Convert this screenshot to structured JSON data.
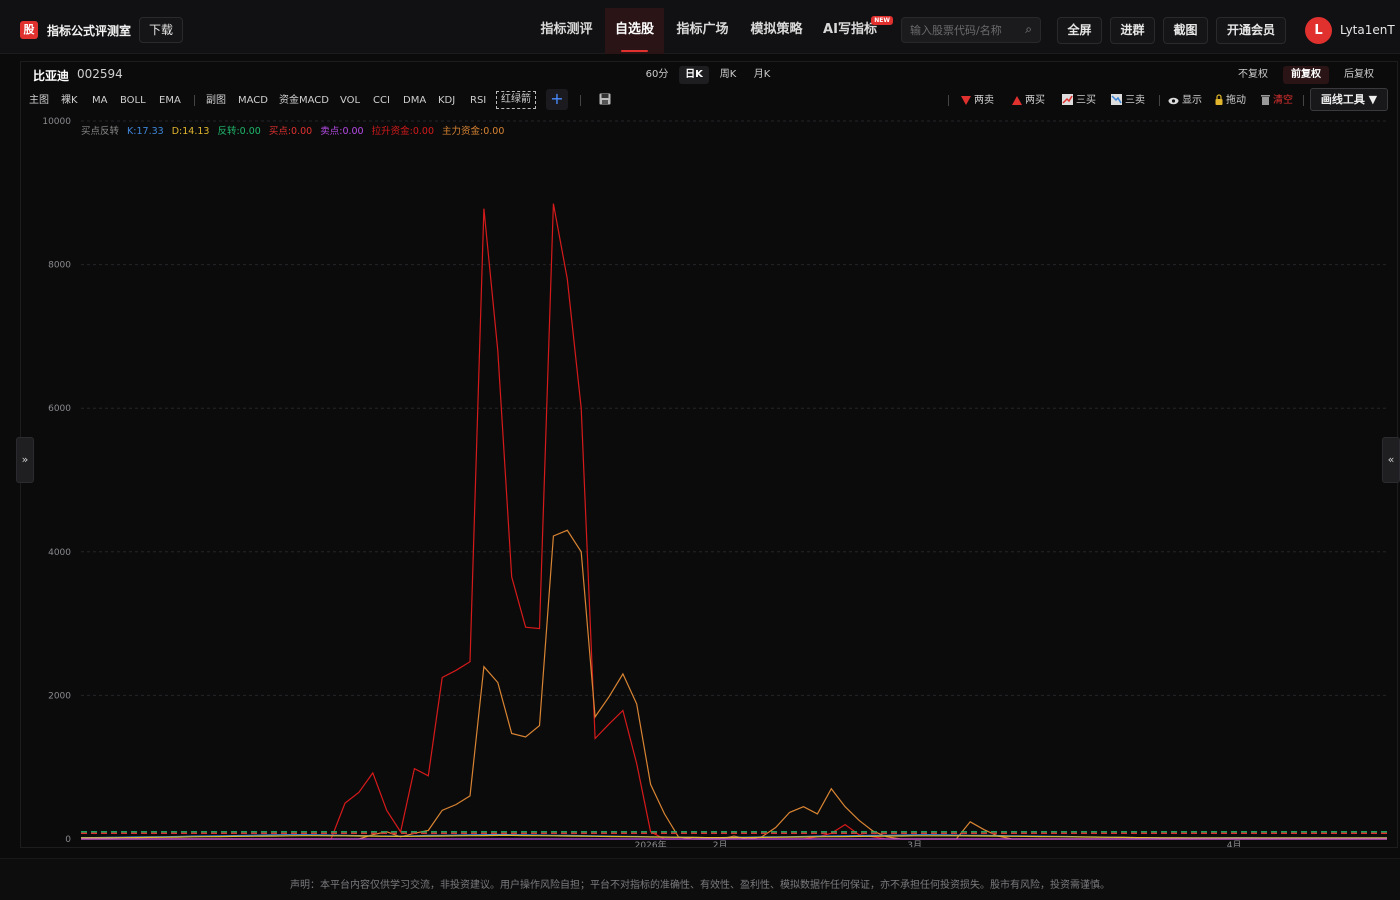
{
  "header": {
    "logo_char": "股",
    "app_title": "指标公式评测室",
    "download": "下载",
    "nav": [
      "指标测评",
      "自选股",
      "指标广场",
      "模拟策略",
      "AI写指标"
    ],
    "nav_active_index": 1,
    "new_badge": "NEW",
    "search_placeholder": "输入股票代码/名称",
    "buttons": [
      "全屏",
      "进群",
      "截图",
      "开通会员"
    ],
    "avatar_letter": "L",
    "username": "Lyta1enT"
  },
  "stock": {
    "name": "比亚迪",
    "code": "002594"
  },
  "periods": [
    "60分",
    "日K",
    "周K",
    "月K"
  ],
  "period_active_index": 1,
  "adjust": [
    "不复权",
    "前复权",
    "后复权"
  ],
  "adjust_active_index": 1,
  "toolbar": {
    "left": [
      "主图",
      "裸K",
      "MA",
      "BOLL",
      "EMA",
      "副图",
      "MACD",
      "资金MACD",
      "VOL",
      "CCI",
      "DMA",
      "KDJ",
      "RSI",
      "红绿箭"
    ],
    "plus": "+",
    "right": [
      "两卖",
      "两买",
      "三买",
      "三卖",
      "显示",
      "拖动",
      "清空"
    ],
    "draw_tool": "画线工具 ▼"
  },
  "indicator_legend": {
    "name": "买点反转",
    "items": [
      "K:17.33",
      "D:14.13",
      "反转:0.00",
      "买点:0.00",
      "卖点:0.00",
      "拉升资金:0.00",
      "主力资金:0.00"
    ]
  },
  "colors": {
    "accent": "#e0312f",
    "k": "#3d86d9",
    "d": "#e1b62c",
    "reverse": "#1fb56a",
    "buy": "#e0312f",
    "sell": "#b64be6",
    "lift": "#d61a1a",
    "main": "#d98432"
  },
  "side_toggles": {
    "left": "»",
    "right": "«"
  },
  "chart_data": {
    "type": "line",
    "ylim": [
      0,
      10000
    ],
    "y_ticks": [
      "10000",
      "8000",
      "6000",
      "4000",
      "2000",
      "0"
    ],
    "x_ticks": [
      "2026年",
      "2月",
      "3月",
      "4月"
    ],
    "x": [
      0,
      1,
      2,
      3,
      4,
      5,
      6,
      7,
      8,
      9,
      10,
      11,
      12,
      13,
      14,
      15,
      16,
      17,
      18,
      19,
      20,
      21,
      22,
      23,
      24,
      25,
      26,
      27,
      28,
      29,
      30,
      31,
      32,
      33,
      34,
      35,
      36,
      37,
      38,
      39,
      40,
      41,
      42,
      43,
      44,
      45,
      46,
      47,
      48,
      49,
      50,
      51,
      52,
      53,
      54,
      55,
      56,
      57,
      58,
      59,
      60,
      61,
      62,
      63,
      64,
      65,
      66,
      67,
      68,
      69,
      70,
      71,
      72,
      73,
      74,
      75,
      76,
      77,
      78,
      79,
      80,
      81,
      82,
      83,
      84,
      85,
      86,
      87,
      88,
      89,
      90,
      91,
      92,
      93,
      94
    ],
    "series": [
      {
        "name": "拉升资金",
        "color": "#d61a1a",
        "values": [
          0,
          0,
          0,
          0,
          0,
          0,
          0,
          0,
          0,
          0,
          0,
          0,
          0,
          0,
          0,
          0,
          0,
          0,
          0,
          500,
          650,
          920,
          400,
          100,
          980,
          880,
          2250,
          2350,
          2470,
          8780,
          6800,
          3650,
          2950,
          2930,
          8850,
          7800,
          6000,
          1400,
          1600,
          1790,
          1050,
          100,
          0,
          0,
          0,
          0,
          0,
          0,
          0,
          0,
          0,
          0,
          0,
          30,
          80,
          200,
          60,
          30,
          0,
          0,
          0,
          0,
          0,
          0,
          0,
          0,
          0,
          0,
          0,
          0,
          0,
          0,
          0,
          0,
          0,
          0,
          0,
          0,
          0,
          0,
          0,
          0,
          0,
          0,
          0,
          0,
          0,
          0,
          0,
          0,
          0,
          0,
          0,
          0,
          0
        ]
      },
      {
        "name": "主力资金",
        "color": "#d98432",
        "values": [
          0,
          0,
          0,
          0,
          0,
          0,
          0,
          0,
          0,
          0,
          0,
          0,
          0,
          0,
          0,
          0,
          0,
          0,
          0,
          0,
          0,
          60,
          100,
          30,
          80,
          120,
          400,
          480,
          600,
          2400,
          2180,
          1470,
          1420,
          1580,
          4220,
          4300,
          4000,
          1700,
          1980,
          2300,
          1880,
          760,
          350,
          30,
          0,
          0,
          0,
          40,
          0,
          30,
          160,
          370,
          450,
          350,
          700,
          450,
          260,
          110,
          30,
          0,
          0,
          0,
          0,
          0,
          240,
          130,
          40,
          0,
          0,
          0,
          0,
          0,
          0,
          0,
          0,
          0,
          0,
          0,
          0,
          0,
          0,
          0,
          0,
          0,
          0,
          0,
          0,
          0,
          0,
          0,
          0,
          0,
          0,
          0,
          0
        ]
      },
      {
        "name": "K",
        "color": "#3d86d9",
        "values": [
          20,
          20,
          22,
          25,
          28,
          30,
          32,
          35,
          40,
          42,
          45,
          48,
          50,
          55,
          58,
          60,
          60,
          58,
          55,
          50,
          48,
          45,
          42,
          40,
          45,
          50,
          52,
          55,
          58,
          60,
          62,
          60,
          58,
          55,
          52,
          50,
          48,
          45,
          40,
          38,
          35,
          30,
          28,
          25,
          22,
          20,
          20,
          22,
          25,
          28,
          30,
          32,
          35,
          40,
          42,
          45,
          48,
          50,
          52,
          55,
          58,
          60,
          58,
          55,
          52,
          50,
          48,
          45,
          42,
          40,
          38,
          35,
          30,
          28,
          25,
          22,
          20,
          18,
          16,
          15,
          15,
          16,
          17,
          18,
          18,
          17,
          17,
          17,
          17,
          17,
          17,
          17,
          17,
          17,
          17
        ]
      },
      {
        "name": "D",
        "color": "#e1b62c",
        "values": [
          15,
          15,
          16,
          18,
          20,
          22,
          24,
          26,
          30,
          32,
          34,
          36,
          38,
          40,
          42,
          45,
          46,
          46,
          45,
          44,
          42,
          40,
          38,
          36,
          38,
          40,
          42,
          44,
          46,
          48,
          50,
          50,
          48,
          46,
          44,
          42,
          40,
          38,
          35,
          33,
          31,
          28,
          26,
          24,
          22,
          20,
          19,
          19,
          20,
          22,
          24,
          26,
          28,
          30,
          32,
          34,
          36,
          38,
          40,
          42,
          44,
          45,
          45,
          44,
          43,
          42,
          40,
          38,
          36,
          34,
          32,
          30,
          28,
          26,
          24,
          22,
          20,
          18,
          16,
          15,
          14,
          14,
          14,
          14,
          14,
          14,
          14,
          14,
          14,
          14,
          14,
          14,
          14,
          14,
          14
        ]
      },
      {
        "name": "反转",
        "color": "#1fb56a",
        "dashed": true,
        "values": [
          100,
          100,
          100,
          100,
          100,
          100,
          100,
          100,
          100,
          100,
          100,
          100,
          100,
          100,
          100,
          100,
          100,
          100,
          100,
          100,
          100,
          100,
          100,
          100,
          100,
          100,
          100,
          100,
          100,
          100,
          100,
          100,
          100,
          100,
          100,
          100,
          100,
          100,
          100,
          100,
          100,
          100,
          100,
          100,
          100,
          100,
          100,
          100,
          100,
          100,
          100,
          100,
          100,
          100,
          100,
          100,
          100,
          100,
          100,
          100,
          100,
          100,
          100,
          100,
          100,
          100,
          100,
          100,
          100,
          100,
          100,
          100,
          100,
          100,
          100,
          100,
          100,
          100,
          100,
          100,
          100,
          100,
          100,
          100,
          100,
          100,
          100,
          100,
          100,
          100,
          100,
          100,
          100,
          100,
          100
        ]
      },
      {
        "name": "买点",
        "color": "#e0312f",
        "dashed": true,
        "values": [
          80,
          80,
          80,
          80,
          80,
          80,
          80,
          80,
          80,
          80,
          80,
          80,
          80,
          80,
          80,
          80,
          80,
          80,
          80,
          80,
          80,
          80,
          80,
          80,
          80,
          80,
          80,
          80,
          80,
          80,
          80,
          80,
          80,
          80,
          80,
          80,
          80,
          80,
          80,
          80,
          80,
          80,
          80,
          80,
          80,
          80,
          80,
          80,
          80,
          80,
          80,
          80,
          80,
          80,
          80,
          80,
          80,
          80,
          80,
          80,
          80,
          80,
          80,
          80,
          80,
          80,
          80,
          80,
          80,
          80,
          80,
          80,
          80,
          80,
          80,
          80,
          80,
          80,
          80,
          80,
          80,
          80,
          80,
          80,
          80,
          80,
          80,
          80,
          80,
          80,
          80,
          80,
          80,
          80,
          80
        ]
      },
      {
        "name": "卖点",
        "color": "#b64be6",
        "values": [
          0,
          0,
          0,
          0,
          0,
          0,
          0,
          0,
          0,
          0,
          0,
          0,
          0,
          0,
          0,
          0,
          0,
          0,
          0,
          0,
          0,
          0,
          0,
          0,
          0,
          0,
          0,
          0,
          0,
          0,
          0,
          0,
          0,
          0,
          0,
          0,
          0,
          0,
          0,
          0,
          0,
          0,
          0,
          0,
          0,
          0,
          0,
          0,
          0,
          0,
          0,
          0,
          0,
          0,
          0,
          0,
          0,
          0,
          0,
          0,
          0,
          0,
          0,
          0,
          0,
          0,
          0,
          0,
          0,
          0,
          0,
          0,
          0,
          0,
          0,
          0,
          0,
          0,
          0,
          0,
          0,
          0,
          0,
          0,
          0,
          0,
          0,
          0,
          0,
          0,
          0,
          0,
          0,
          0,
          0
        ]
      }
    ]
  },
  "footer": "声明：本平台内容仅供学习交流，非投资建议。用户操作风险自担；平台不对指标的准确性、有效性、盈利性、模拟数据作任何保证，亦不承担任何投资损失。股市有风险，投资需谨慎。"
}
